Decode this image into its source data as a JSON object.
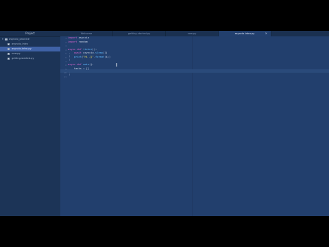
{
  "sidebar": {
    "title": "Project",
    "items": [
      {
        "label": "asyncio_practice",
        "type": "folder",
        "expanded": true,
        "icon": "folder-icon"
      },
      {
        "label": "asyncio_intro",
        "type": "file",
        "icon": "file-icon"
      },
      {
        "label": "asyncio-intro.py",
        "type": "file",
        "icon": "file-icon",
        "selected": true
      },
      {
        "label": "new.py",
        "type": "file",
        "icon": "file-icon"
      },
      {
        "label": "getting-started.py",
        "type": "file",
        "icon": "file-icon"
      }
    ]
  },
  "tabs": [
    {
      "label": "Welcome",
      "active": false
    },
    {
      "label": "getting-started.py",
      "active": false
    },
    {
      "label": "new.py",
      "active": false
    },
    {
      "label": "asyncio-intro.py",
      "active": true,
      "close": "×"
    }
  ],
  "editor": {
    "line_numbers": [
      "1",
      "2",
      "3",
      "4",
      "5",
      "6",
      "7",
      "8",
      "9",
      "10",
      "11"
    ],
    "current_line": 10
  },
  "colors": {
    "keyword": "#e066d0",
    "function": "#5fb9ff",
    "string": "#e3d45f",
    "selected_item": "#3f62a6"
  }
}
